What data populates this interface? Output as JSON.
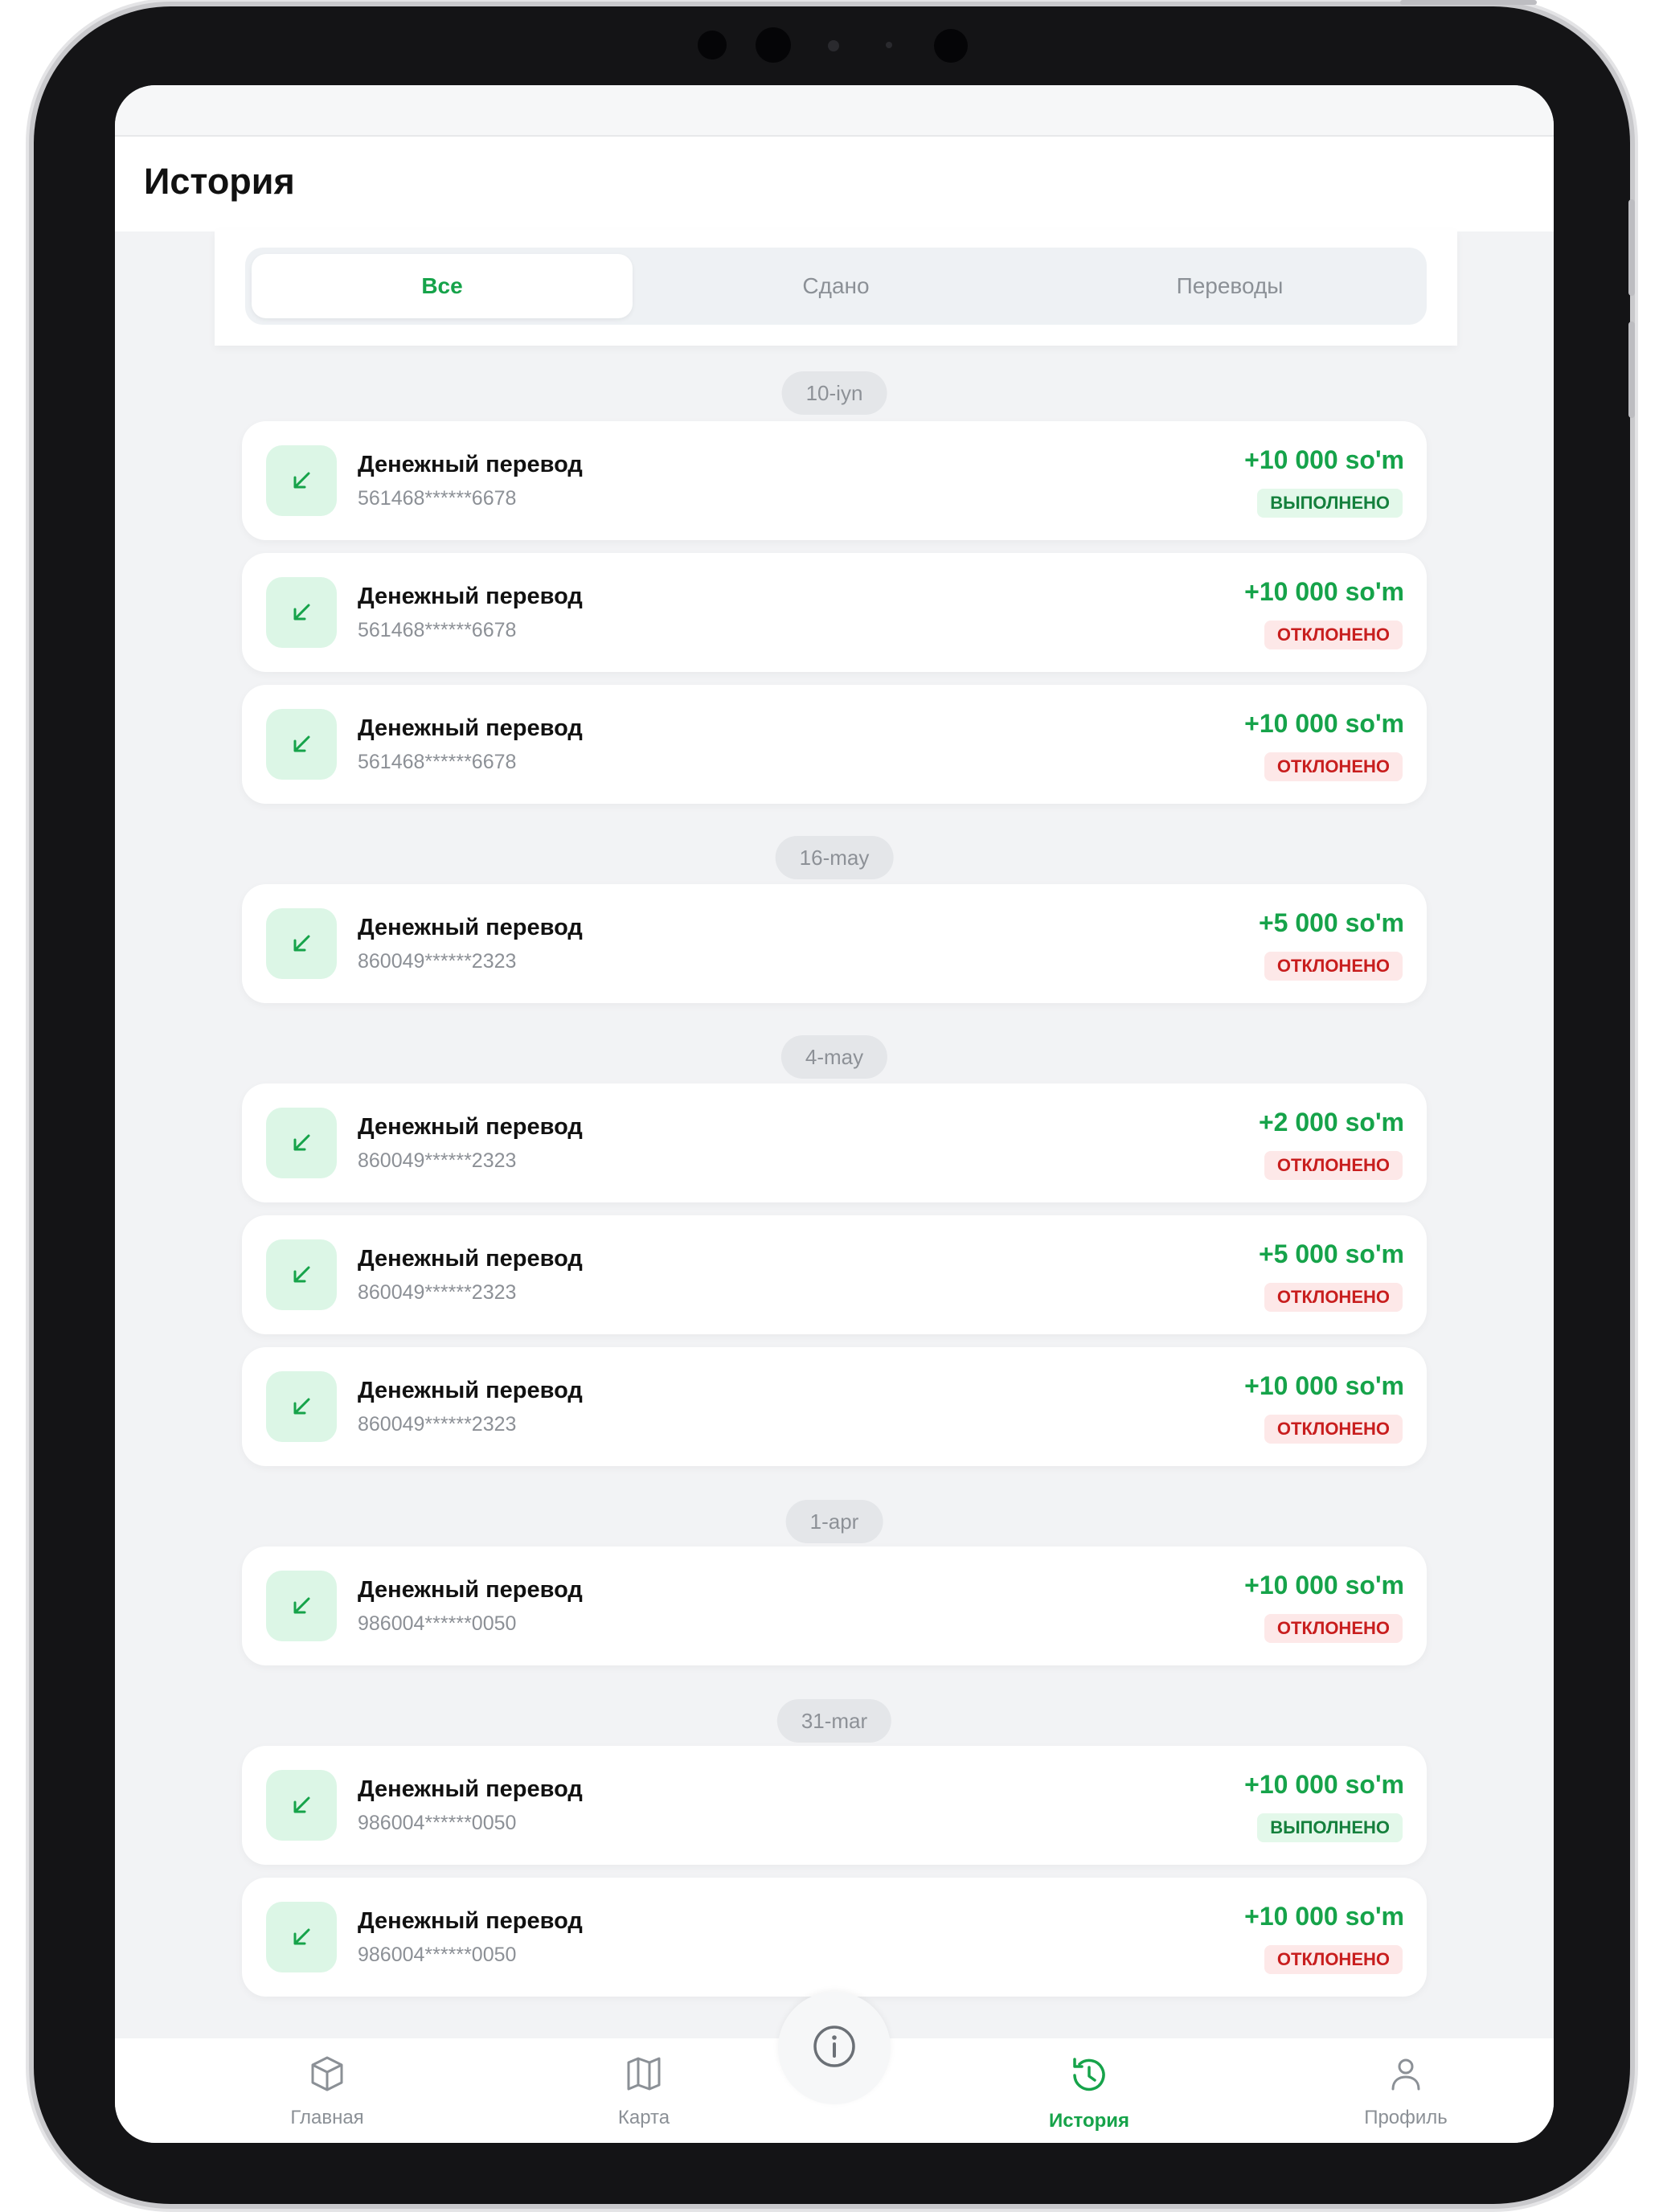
{
  "header": {
    "title": "История"
  },
  "tabs": [
    {
      "label": "Все",
      "active": true
    },
    {
      "label": "Сдано",
      "active": false
    },
    {
      "label": "Переводы",
      "active": false
    }
  ],
  "dates": [
    "10-iyn",
    "16-may",
    "4-may",
    "1-apr",
    "31-mar"
  ],
  "transactions": [
    {
      "title": "Денежный перевод",
      "card": "561468******6678",
      "amount": "+10 000 so'm",
      "status": "ВЫПОЛНЕНО",
      "status_type": "success"
    },
    {
      "title": "Денежный перевод",
      "card": "561468******6678",
      "amount": "+10 000 so'm",
      "status": "ОТКЛОНЕНО",
      "status_type": "rejected"
    },
    {
      "title": "Денежный перевод",
      "card": "561468******6678",
      "amount": "+10 000 so'm",
      "status": "ОТКЛОНЕНО",
      "status_type": "rejected"
    },
    {
      "title": "Денежный перевод",
      "card": "860049******2323",
      "amount": "+5 000 so'm",
      "status": "ОТКЛОНЕНО",
      "status_type": "rejected"
    },
    {
      "title": "Денежный перевод",
      "card": "860049******2323",
      "amount": "+2 000 so'm",
      "status": "ОТКЛОНЕНО",
      "status_type": "rejected"
    },
    {
      "title": "Денежный перевод",
      "card": "860049******2323",
      "amount": "+5 000 so'm",
      "status": "ОТКЛОНЕНО",
      "status_type": "rejected"
    },
    {
      "title": "Денежный перевод",
      "card": "860049******2323",
      "amount": "+10 000 so'm",
      "status": "ОТКЛОНЕНО",
      "status_type": "rejected"
    },
    {
      "title": "Денежный перевод",
      "card": "986004******0050",
      "amount": "+10 000 so'm",
      "status": "ОТКЛОНЕНО",
      "status_type": "rejected"
    },
    {
      "title": "Денежный перевод",
      "card": "986004******0050",
      "amount": "+10 000 so'm",
      "status": "ВЫПОЛНЕНО",
      "status_type": "success"
    },
    {
      "title": "Денежный перевод",
      "card": "986004******0050",
      "amount": "+10 000 so'm",
      "status": "ОТКЛОНЕНО",
      "status_type": "rejected"
    }
  ],
  "transaction_icon": "arrow-down-left-icon",
  "nav": [
    {
      "label": "Главная",
      "icon": "cube-icon",
      "active": false
    },
    {
      "label": "Карта",
      "icon": "map-icon",
      "active": false
    },
    {
      "label": "",
      "icon": "info-icon",
      "active": false
    },
    {
      "label": "История",
      "icon": "history-icon",
      "active": true
    },
    {
      "label": "Профиль",
      "icon": "user-icon",
      "active": false
    }
  ],
  "colors": {
    "accent": "#16a34a",
    "success_bg": "#e3f8ea",
    "rejected": "#c81e1e",
    "rejected_bg": "#fde8e8"
  }
}
